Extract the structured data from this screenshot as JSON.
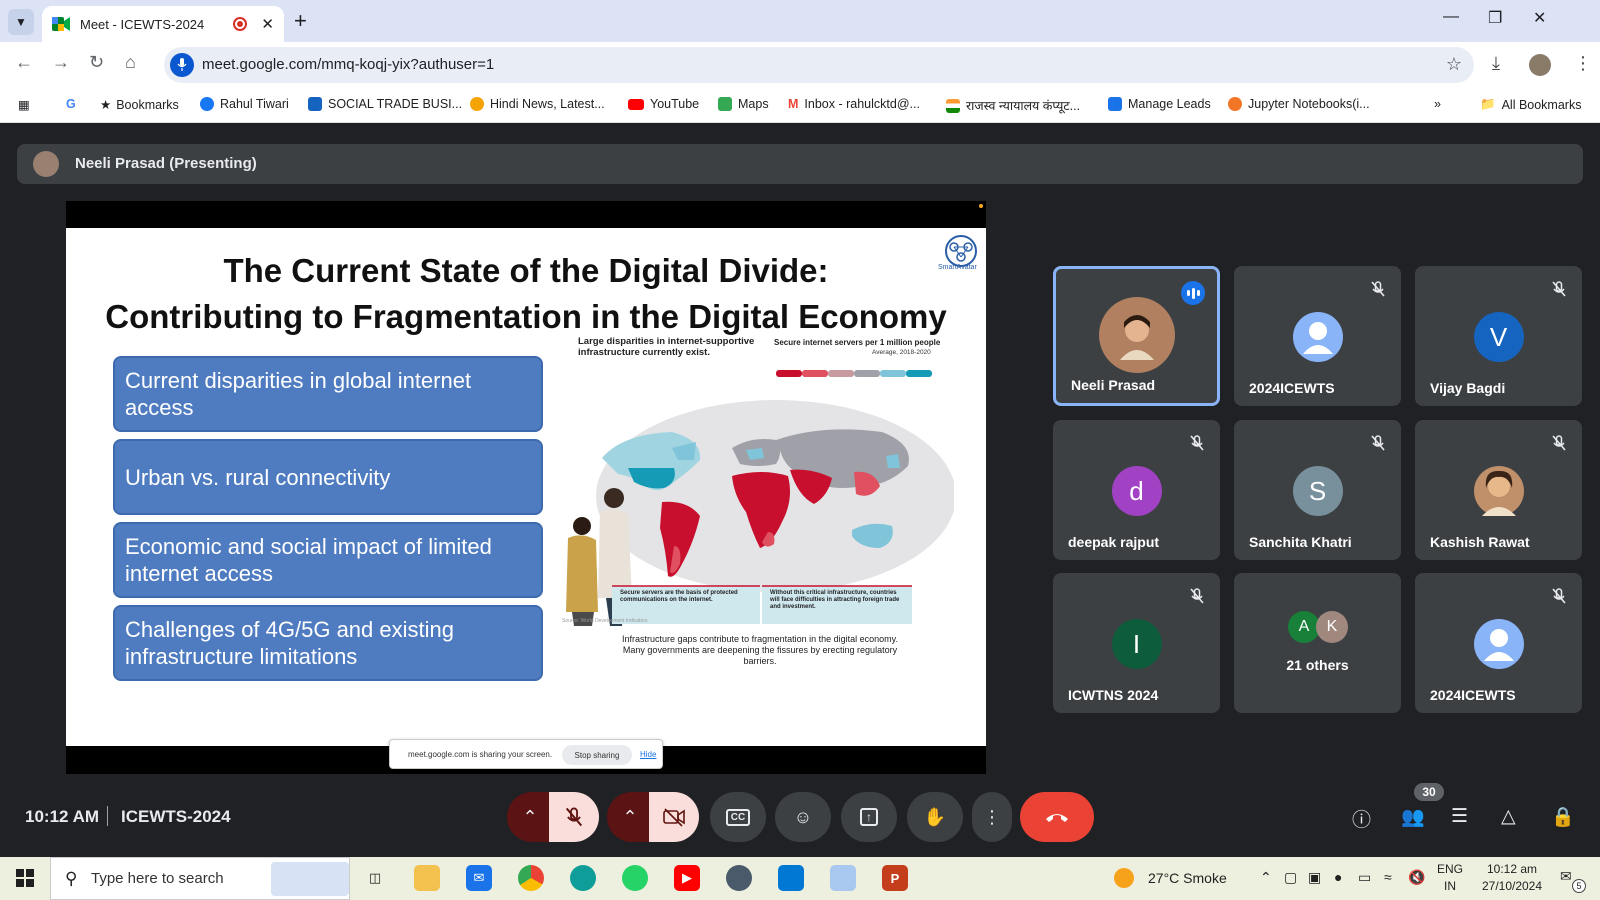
{
  "browser": {
    "tab_title": "Meet - ICEWTS-2024",
    "url": "meet.google.com/mmq-koqj-yix?authuser=1",
    "bookmarks": [
      "Bookmarks",
      "Rahul Tiwari",
      "SOCIAL TRADE BUSI...",
      "Hindi News, Latest...",
      "YouTube",
      "Maps",
      "Inbox - rahulcktd@...",
      "राजस्व न्यायालय कंप्यूट...",
      "Manage Leads",
      "Jupyter Notebooks(i..."
    ],
    "all_bookmarks": "All Bookmarks"
  },
  "meet": {
    "presenter_label": "Neeli Prasad (Presenting)",
    "time": "10:12 AM",
    "meeting_code": "ICEWTS-2024",
    "participant_count": "30",
    "slide": {
      "title_line1": "The Current State of the Digital Divide:",
      "title_line2": "Contributing to Fragmentation in the Digital Economy",
      "logo_text": "SmartAvatar",
      "bullets": [
        "Current disparities in global internet access",
        "Urban vs. rural connectivity",
        "Economic and social impact of limited internet access",
        "Challenges of 4G/5G and existing infrastructure limitations"
      ],
      "infographic": {
        "heading": "Large disparities in internet-supportive infrastructure currently exist.",
        "legend_title": "Secure internet servers per 1 million people",
        "legend_subtitle": "Average, 2018-2020",
        "legend_ranges": [
          "<300",
          "300-1,000",
          "1,000-5,000",
          "5,000-25,000",
          "25,000-100,000",
          "100,000"
        ],
        "note_left": "Secure servers are the basis of protected communications on the internet.",
        "note_right": "Without this critical infrastructure, countries will face difficulties in attracting foreign trade and investment.",
        "source": "Source: World Development Indicators",
        "caption": "Infrastructure gaps contribute to fragmentation in the digital economy. Many governments are deepening the fissures by erecting regulatory barriers."
      }
    },
    "share_notice": {
      "text": "meet.google.com is sharing your screen.",
      "stop": "Stop sharing",
      "hide": "Hide"
    },
    "participants": [
      {
        "name": "Neeli Prasad",
        "initial": "",
        "color": "#b08060",
        "speaking": true
      },
      {
        "name": "2024ICEWTS",
        "initial": "",
        "color": "#8ab4f8",
        "speaking": false
      },
      {
        "name": "Vijay Bagdi",
        "initial": "V",
        "color": "#1565c0",
        "speaking": false
      },
      {
        "name": "deepak rajput",
        "initial": "d",
        "color": "#a142c4",
        "speaking": false
      },
      {
        "name": "Sanchita Khatri",
        "initial": "S",
        "color": "#78909c",
        "speaking": false
      },
      {
        "name": "Kashish Rawat",
        "initial": "",
        "color": "#c0906a",
        "speaking": false
      },
      {
        "name": "ICWTNS 2024",
        "initial": "I",
        "color": "#0d5c3b",
        "speaking": false
      },
      {
        "name": "21 others",
        "initial": "",
        "color": "",
        "speaking": false
      },
      {
        "name": "2024ICEWTS",
        "initial": "",
        "color": "#8ab4f8",
        "speaking": false
      }
    ],
    "others_initials": [
      "A",
      "K"
    ]
  },
  "taskbar": {
    "search_placeholder": "Type here to search",
    "weather": "27°C  Smoke",
    "lang_top": "ENG",
    "lang_bottom": "IN",
    "time": "10:12 am",
    "date": "27/10/2024",
    "notifications": "5"
  },
  "colors": {
    "meet_bg": "#202124",
    "end_call": "#ea4335",
    "slide_box": "#4f7cc1"
  }
}
